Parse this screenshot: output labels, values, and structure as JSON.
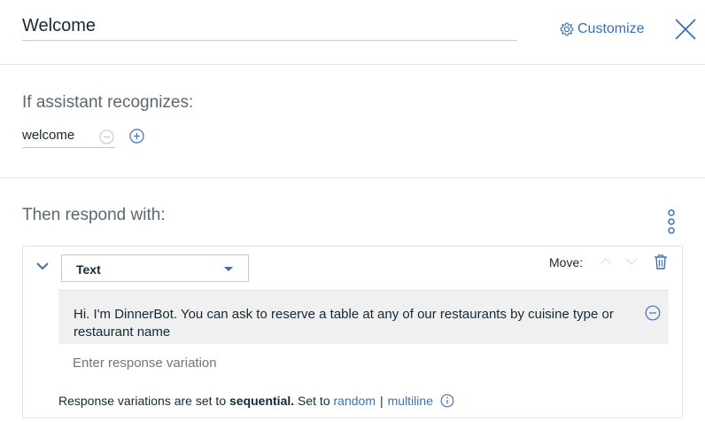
{
  "header": {
    "title": "Welcome",
    "customize_label": "Customize"
  },
  "condition": {
    "heading": "If assistant recognizes:",
    "value": "welcome"
  },
  "response": {
    "heading": "Then respond with:",
    "type_selected": "Text",
    "move_label": "Move:",
    "variations": [
      "Hi. I'm DinnerBot. You can ask to reserve a table at any of our restaurants by cuisine type or restaurant name"
    ],
    "new_variation_placeholder": "Enter response variation",
    "footer": {
      "prefix": "Response variations are set to",
      "mode": "sequential.",
      "set_to": "Set to",
      "option_random": "random",
      "separator": "|",
      "option_multiline": "multiline"
    }
  },
  "colors": {
    "accent": "#3d70b2",
    "text": "#152935",
    "muted": "#5a6872",
    "border": "#dfe3e6",
    "variation_bg": "#f0f0f0"
  },
  "icons": [
    "gear-icon",
    "close-icon",
    "minus-circle-icon",
    "plus-circle-icon",
    "overflow-menu-icon",
    "chevron-down-icon",
    "caret-down-icon",
    "arrow-up-icon",
    "arrow-down-icon",
    "trash-icon",
    "info-icon"
  ]
}
